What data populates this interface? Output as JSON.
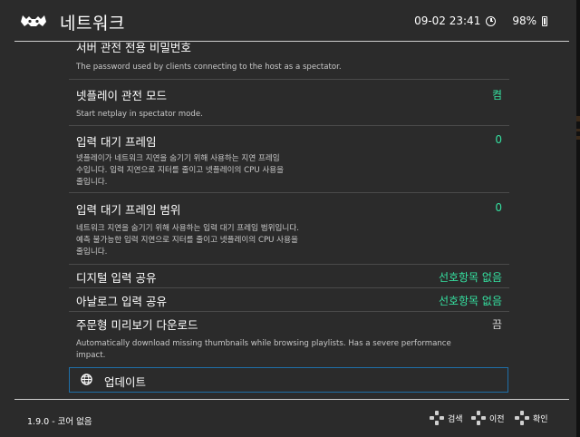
{
  "header": {
    "title": "네트워크",
    "datetime": "09-02 23:41",
    "battery": "98%"
  },
  "items": [
    {
      "label": "서버 관전 전용 비밀번호",
      "value": "",
      "desc": [
        "The password used by clients connecting to the host as a spectator."
      ]
    },
    {
      "label": "넷플레이 관전 모드",
      "value": "켬",
      "desc": [
        "Start netplay in spectator mode."
      ]
    },
    {
      "label": "입력 대기 프레임",
      "value": "0",
      "desc": [
        "넷플레이가 네트워크 지연을 숨기기 위해 사용하는 지연 프레임",
        "수입니다. 입력 지연으로 지터를 줄이고 넷플레이의 CPU 사용을",
        "줄입니다."
      ]
    },
    {
      "label": "입력 대기 프레임 범위",
      "value": "0",
      "desc": [
        "네트워크 지연을 숨기기 위해 사용하는 입력 대기 프레임 범위입니다.",
        "예측 불가능한 입력 지연으로 지터를 줄이고 넷플레이의 CPU 사용을",
        "줄입니다."
      ]
    },
    {
      "label": "디지털 입력 공유",
      "value": "선호항목 없음",
      "desc": []
    },
    {
      "label": "아날로그 입력 공유",
      "value": "선호항목 없음",
      "desc": []
    },
    {
      "label": "주문형 미리보기 다운로드",
      "value": "끔",
      "desc": [
        "Automatically download missing thumbnails while browsing playlists. Has a severe performance",
        "impact."
      ]
    }
  ],
  "selected_item": {
    "label": "업데이트",
    "icon": "globe-icon"
  },
  "footer": {
    "core": "1.9.0 - 코어 없음",
    "hints": [
      {
        "label": "검색",
        "icon": "dpad-icon"
      },
      {
        "label": "이전",
        "icon": "dpad-icon"
      },
      {
        "label": "확인",
        "icon": "dpad-icon"
      }
    ]
  },
  "colors": {
    "accent": "#35e0a0",
    "selection_border": "#1f6fa8",
    "background": "#2b2b2b"
  }
}
